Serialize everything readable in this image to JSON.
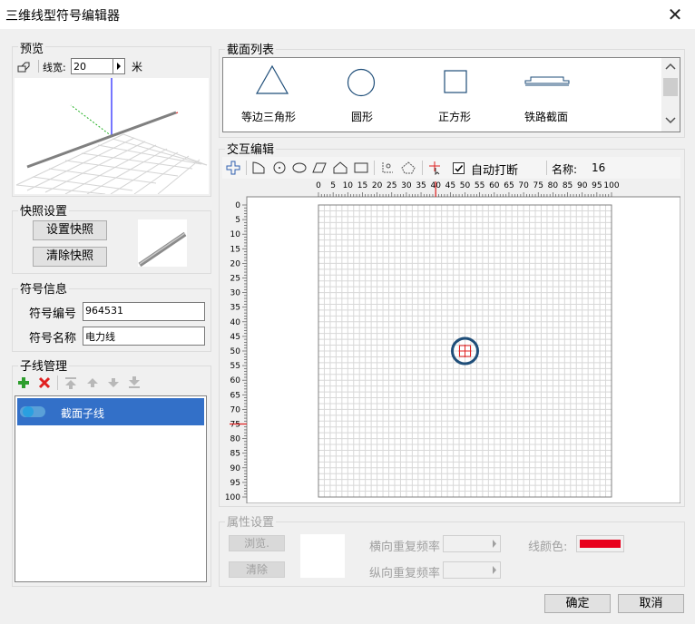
{
  "window": {
    "title": "三维线型符号编辑器",
    "close_glyph": "✕"
  },
  "preview": {
    "group_label": "预览",
    "linewidth_label": "线宽:",
    "linewidth_value": "20",
    "unit": "米"
  },
  "snapshot": {
    "group_label": "快照设置",
    "set_button": "设置快照",
    "clear_button": "清除快照"
  },
  "symbol_info": {
    "group_label": "符号信息",
    "id_label": "符号编号",
    "id_value": "964531",
    "name_label": "符号名称",
    "name_value": "电力线"
  },
  "subline": {
    "group_label": "子线管理",
    "items": [
      {
        "label": "截面子线",
        "selected": true
      }
    ]
  },
  "section_list": {
    "group_label": "截面列表",
    "items": [
      {
        "label": "等边三角形",
        "icon": "triangle-icon"
      },
      {
        "label": "圆形",
        "icon": "circle-icon"
      },
      {
        "label": "正方形",
        "icon": "square-icon"
      },
      {
        "label": "铁路截面",
        "icon": "rail-section-icon"
      }
    ]
  },
  "interactive": {
    "group_label": "交互编辑",
    "auto_break_label": "自动打断",
    "auto_break_checked": true,
    "name_label": "名称:",
    "name_value": "16",
    "ruler_ticks": [
      "0",
      "5",
      "10",
      "15",
      "20",
      "25",
      "30",
      "35",
      "40",
      "45",
      "50",
      "55",
      "60",
      "65",
      "70",
      "75",
      "80",
      "85",
      "90",
      "95",
      "100"
    ],
    "ruler_v_ticks": [
      "0",
      "5",
      "10",
      "15",
      "20",
      "25",
      "30",
      "35",
      "40",
      "45",
      "50",
      "55",
      "60",
      "65",
      "70",
      "75",
      "80",
      "85",
      "90",
      "95",
      "100"
    ],
    "h_marker": 40,
    "v_marker": 75,
    "shape_center": [
      50,
      50
    ]
  },
  "attributes": {
    "group_label": "属性设置",
    "browse_button": "浏览.",
    "clear_button": "清除",
    "h_repeat_label": "横向重复频率",
    "v_repeat_label": "纵向重复频率",
    "line_color_label": "线颜色:",
    "line_color": "#e8001c"
  },
  "footer": {
    "ok_button": "确定",
    "cancel_button": "取消"
  },
  "colors": {
    "accent_select": "#3370c8",
    "shape_circle": "#1f4e79",
    "marker_red": "#e02020"
  }
}
